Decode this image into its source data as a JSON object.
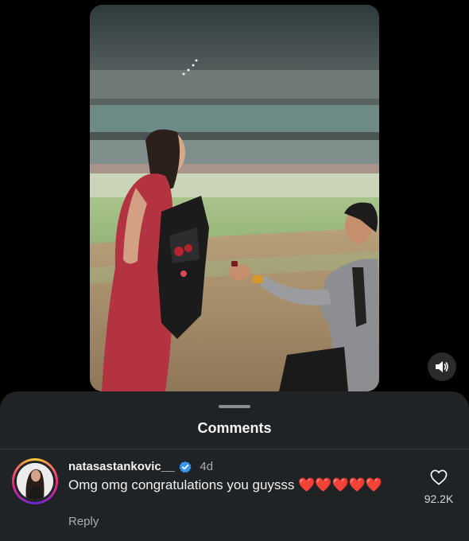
{
  "comments_sheet": {
    "title": "Comments"
  },
  "comment": {
    "username": "natasastankovic__",
    "time": "4d",
    "text": "Omg omg congratulations you guysss ❤️❤️❤️❤️❤️",
    "reply_label": "Reply",
    "like_count": "92.2K"
  },
  "icons": {
    "volume": "speaker-icon",
    "verified": "verified-badge-icon",
    "like": "heart-outline-icon"
  },
  "colors": {
    "sheet_background": "#1f2326",
    "verified_blue": "#3897f0",
    "story_ring": [
      "#f9ce34",
      "#ee2a7b",
      "#6228d7"
    ]
  }
}
